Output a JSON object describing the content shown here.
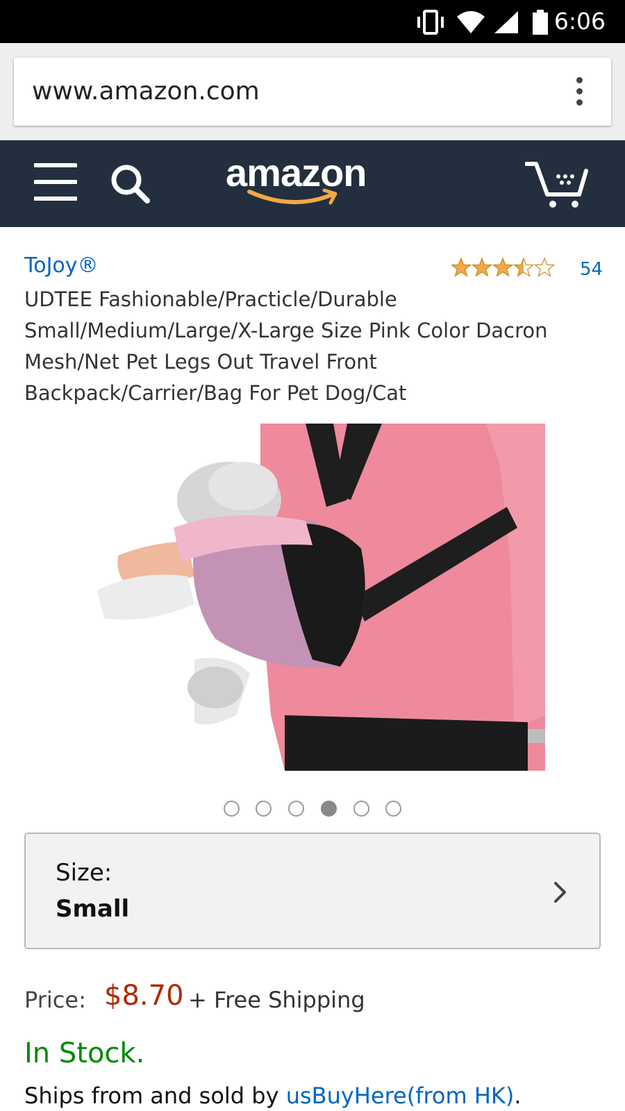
{
  "status_bar": {
    "time": "6:06"
  },
  "browser": {
    "url": "www.amazon.com"
  },
  "header": {
    "logo_text": "amazon"
  },
  "product": {
    "brand": "ToJoy®",
    "rating_stars": 3.5,
    "review_count": "54",
    "title": "UDTEE Fashionable/Practicle/Durable Small/Medium/Large/X-Large Size Pink Color Dacron Mesh/Net Pet Legs Out Travel Front Backpack/Carrier/Bag For Pet Dog/Cat",
    "image_count": 6,
    "active_image_index": 3
  },
  "size_selector": {
    "label": "Size:",
    "value": "Small"
  },
  "price": {
    "label": "Price:",
    "value": "$8.70",
    "shipping": "+ Free Shipping"
  },
  "availability": {
    "stock": "In Stock.",
    "ships_prefix": "Ships from and sold by",
    "seller": "usBuyHere(from HK)",
    "ships_suffix": "."
  },
  "colors": {
    "header_bg": "#232f3e",
    "link": "#0066c0",
    "price": "#b12704",
    "in_stock": "#008a00",
    "star": "#f3a847"
  }
}
